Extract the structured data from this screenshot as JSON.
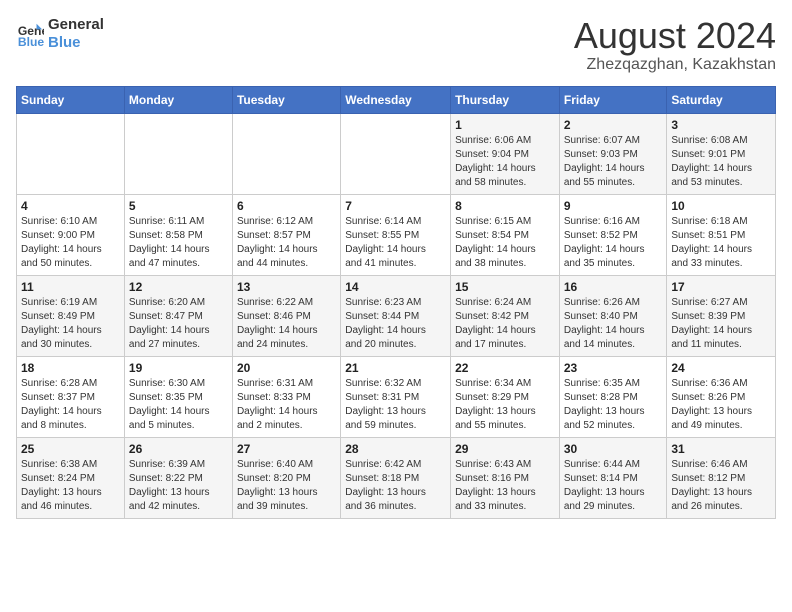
{
  "header": {
    "logo_line1": "General",
    "logo_line2": "Blue",
    "title": "August 2024",
    "subtitle": "Zhezqazghan, Kazakhstan"
  },
  "weekdays": [
    "Sunday",
    "Monday",
    "Tuesday",
    "Wednesday",
    "Thursday",
    "Friday",
    "Saturday"
  ],
  "weeks": [
    [
      {
        "day": "",
        "detail": ""
      },
      {
        "day": "",
        "detail": ""
      },
      {
        "day": "",
        "detail": ""
      },
      {
        "day": "",
        "detail": ""
      },
      {
        "day": "1",
        "detail": "Sunrise: 6:06 AM\nSunset: 9:04 PM\nDaylight: 14 hours\nand 58 minutes."
      },
      {
        "day": "2",
        "detail": "Sunrise: 6:07 AM\nSunset: 9:03 PM\nDaylight: 14 hours\nand 55 minutes."
      },
      {
        "day": "3",
        "detail": "Sunrise: 6:08 AM\nSunset: 9:01 PM\nDaylight: 14 hours\nand 53 minutes."
      }
    ],
    [
      {
        "day": "4",
        "detail": "Sunrise: 6:10 AM\nSunset: 9:00 PM\nDaylight: 14 hours\nand 50 minutes."
      },
      {
        "day": "5",
        "detail": "Sunrise: 6:11 AM\nSunset: 8:58 PM\nDaylight: 14 hours\nand 47 minutes."
      },
      {
        "day": "6",
        "detail": "Sunrise: 6:12 AM\nSunset: 8:57 PM\nDaylight: 14 hours\nand 44 minutes."
      },
      {
        "day": "7",
        "detail": "Sunrise: 6:14 AM\nSunset: 8:55 PM\nDaylight: 14 hours\nand 41 minutes."
      },
      {
        "day": "8",
        "detail": "Sunrise: 6:15 AM\nSunset: 8:54 PM\nDaylight: 14 hours\nand 38 minutes."
      },
      {
        "day": "9",
        "detail": "Sunrise: 6:16 AM\nSunset: 8:52 PM\nDaylight: 14 hours\nand 35 minutes."
      },
      {
        "day": "10",
        "detail": "Sunrise: 6:18 AM\nSunset: 8:51 PM\nDaylight: 14 hours\nand 33 minutes."
      }
    ],
    [
      {
        "day": "11",
        "detail": "Sunrise: 6:19 AM\nSunset: 8:49 PM\nDaylight: 14 hours\nand 30 minutes."
      },
      {
        "day": "12",
        "detail": "Sunrise: 6:20 AM\nSunset: 8:47 PM\nDaylight: 14 hours\nand 27 minutes."
      },
      {
        "day": "13",
        "detail": "Sunrise: 6:22 AM\nSunset: 8:46 PM\nDaylight: 14 hours\nand 24 minutes."
      },
      {
        "day": "14",
        "detail": "Sunrise: 6:23 AM\nSunset: 8:44 PM\nDaylight: 14 hours\nand 20 minutes."
      },
      {
        "day": "15",
        "detail": "Sunrise: 6:24 AM\nSunset: 8:42 PM\nDaylight: 14 hours\nand 17 minutes."
      },
      {
        "day": "16",
        "detail": "Sunrise: 6:26 AM\nSunset: 8:40 PM\nDaylight: 14 hours\nand 14 minutes."
      },
      {
        "day": "17",
        "detail": "Sunrise: 6:27 AM\nSunset: 8:39 PM\nDaylight: 14 hours\nand 11 minutes."
      }
    ],
    [
      {
        "day": "18",
        "detail": "Sunrise: 6:28 AM\nSunset: 8:37 PM\nDaylight: 14 hours\nand 8 minutes."
      },
      {
        "day": "19",
        "detail": "Sunrise: 6:30 AM\nSunset: 8:35 PM\nDaylight: 14 hours\nand 5 minutes."
      },
      {
        "day": "20",
        "detail": "Sunrise: 6:31 AM\nSunset: 8:33 PM\nDaylight: 14 hours\nand 2 minutes."
      },
      {
        "day": "21",
        "detail": "Sunrise: 6:32 AM\nSunset: 8:31 PM\nDaylight: 13 hours\nand 59 minutes."
      },
      {
        "day": "22",
        "detail": "Sunrise: 6:34 AM\nSunset: 8:29 PM\nDaylight: 13 hours\nand 55 minutes."
      },
      {
        "day": "23",
        "detail": "Sunrise: 6:35 AM\nSunset: 8:28 PM\nDaylight: 13 hours\nand 52 minutes."
      },
      {
        "day": "24",
        "detail": "Sunrise: 6:36 AM\nSunset: 8:26 PM\nDaylight: 13 hours\nand 49 minutes."
      }
    ],
    [
      {
        "day": "25",
        "detail": "Sunrise: 6:38 AM\nSunset: 8:24 PM\nDaylight: 13 hours\nand 46 minutes."
      },
      {
        "day": "26",
        "detail": "Sunrise: 6:39 AM\nSunset: 8:22 PM\nDaylight: 13 hours\nand 42 minutes."
      },
      {
        "day": "27",
        "detail": "Sunrise: 6:40 AM\nSunset: 8:20 PM\nDaylight: 13 hours\nand 39 minutes."
      },
      {
        "day": "28",
        "detail": "Sunrise: 6:42 AM\nSunset: 8:18 PM\nDaylight: 13 hours\nand 36 minutes."
      },
      {
        "day": "29",
        "detail": "Sunrise: 6:43 AM\nSunset: 8:16 PM\nDaylight: 13 hours\nand 33 minutes."
      },
      {
        "day": "30",
        "detail": "Sunrise: 6:44 AM\nSunset: 8:14 PM\nDaylight: 13 hours\nand 29 minutes."
      },
      {
        "day": "31",
        "detail": "Sunrise: 6:46 AM\nSunset: 8:12 PM\nDaylight: 13 hours\nand 26 minutes."
      }
    ]
  ]
}
